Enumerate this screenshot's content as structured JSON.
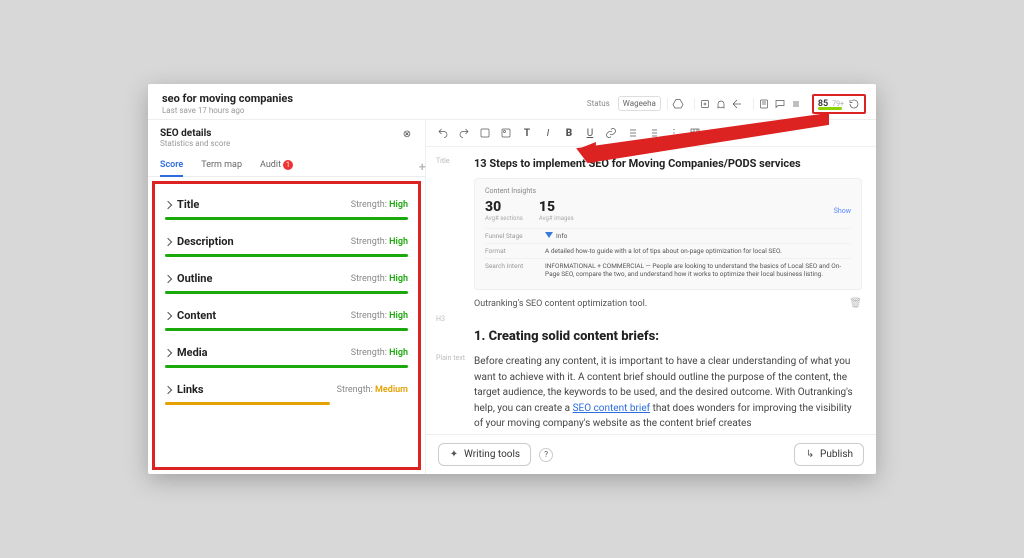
{
  "header": {
    "title": "seo for moving companies",
    "last_save": "Last save 17 hours ago",
    "status_label": "Status",
    "status_value": "Wageeha"
  },
  "score_widget": {
    "score": "85",
    "max": "79+",
    "bar_color": "#8cd400"
  },
  "seo_panel": {
    "title": "SEO details",
    "subtitle": "Statistics and score",
    "tabs": {
      "score": "Score",
      "termmap": "Term map",
      "audit": "Audit",
      "audit_badge": "1"
    },
    "metrics": [
      {
        "name": "Title",
        "strength": "High",
        "level": "high"
      },
      {
        "name": "Description",
        "strength": "High",
        "level": "high"
      },
      {
        "name": "Outline",
        "strength": "High",
        "level": "high"
      },
      {
        "name": "Content",
        "strength": "High",
        "level": "high"
      },
      {
        "name": "Media",
        "strength": "High",
        "level": "high"
      },
      {
        "name": "Links",
        "strength": "Medium",
        "level": "medium"
      }
    ],
    "strength_label": "Strength: "
  },
  "editor": {
    "gutter_title": "Title",
    "doc_title": "13 Steps to implement SEO for Moving Companies/PODS services",
    "insight": {
      "header": "Content Insights",
      "stat1_value": "30",
      "stat1_label": "Avg# sections",
      "stat2_value": "15",
      "stat2_label": "Avg# images",
      "show": "Show",
      "funnel_label": "Funnel Stage",
      "funnel_value": "Info",
      "format_label": "Format",
      "format_value": "A detailed how-to guide with a lot of tips about on-page optimization for local SEO.",
      "intent_label": "Search Intent",
      "intent_value": "INFORMATIONAL + COMMERCIAL — People are looking to understand the basics of Local SEO and On-Page SEO, compare the two, and understand how it works to optimize their local business listing."
    },
    "caption": "Outranking's SEO content optimization tool.",
    "gutter_h3": "H3",
    "h3": "1. Creating solid content briefs:",
    "gutter_plain": "Plain text",
    "para_before": "Before creating any content, it is important to have a clear understanding of what you want to achieve with it. A content brief should outline the purpose of the content, the target audience, the keywords to be used, and the desired outcome. With Outranking's help, you can create a ",
    "para_link": "SEO content brief",
    "para_after": " that does wonders for improving the visibility of your moving company's website as the content brief creates"
  },
  "footer": {
    "writing_tools": "Writing tools",
    "publish": "Publish"
  }
}
